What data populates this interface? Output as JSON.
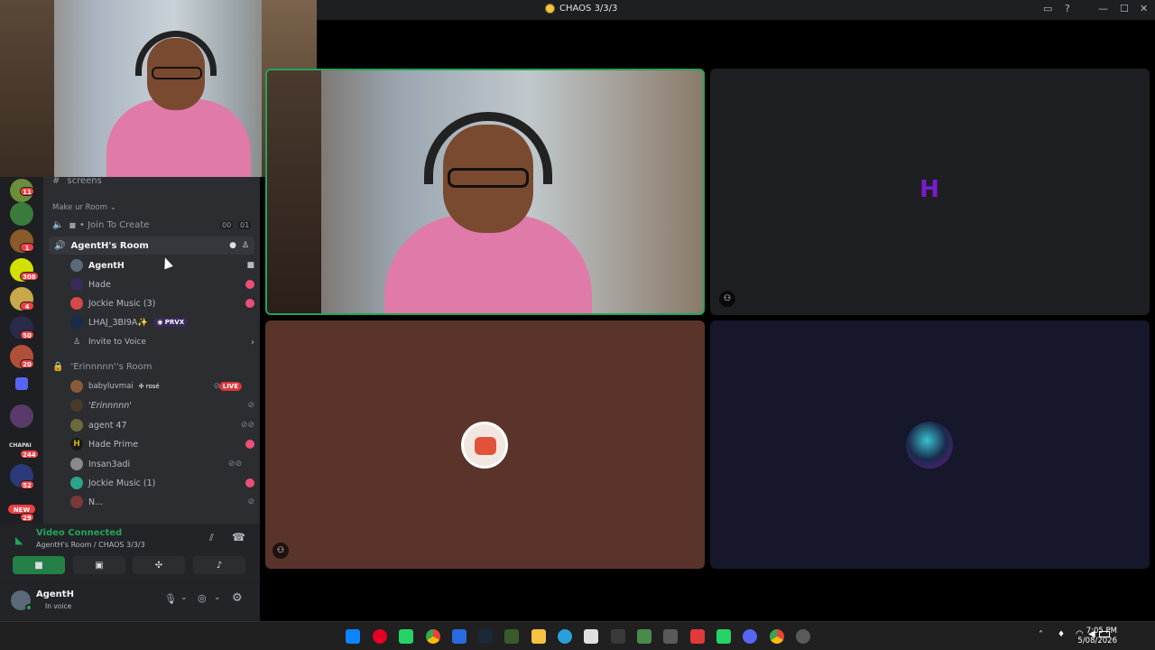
{
  "window": {
    "title": "CHAOS 3/3/3"
  },
  "guilds": {
    "badges": [
      "11",
      "1",
      "308",
      "4",
      "50",
      "20",
      "CHAPAI",
      "244",
      "52",
      "NEW",
      "29"
    ]
  },
  "channels": {
    "screens": "screens",
    "category": "Make ur Room",
    "join_to_create": "• Join To Create",
    "jtc_count_a": "00",
    "jtc_count_b": "01",
    "room1": "AgentH's Room",
    "room1_users": [
      "AgentH",
      "Hade",
      "Jockie Music (3)",
      "LHAJ_3BI9A✨"
    ],
    "prvx": "PRVX",
    "invite": "Invite to Voice",
    "room2": "'Erinnnnn''s Room",
    "room2_users": [
      "babyluvmai",
      "'Erinnnnn'",
      "agent 47",
      "Hade Prime",
      "Insan3adi",
      "Jockie Music (1)",
      "N..."
    ],
    "rose": "rosé",
    "live": "LIVE"
  },
  "voice": {
    "status": "Video Connected",
    "location": "AgentH's Room / CHAOS 3/3/3"
  },
  "user": {
    "name": "AgentH",
    "status": "In voice"
  },
  "taskbar": {
    "time": "7:05 PM",
    "date": "5/08/2026"
  },
  "colors": {
    "accent": "#23a55a",
    "brand": "#5865f2",
    "danger": "#f23f43"
  }
}
